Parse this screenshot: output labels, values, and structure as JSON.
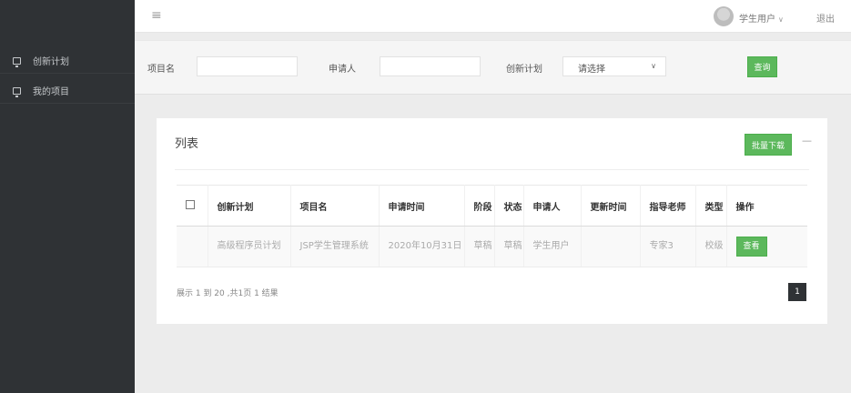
{
  "sidebar": {
    "items": [
      {
        "label": "创新计划",
        "icon": "monitor-icon"
      },
      {
        "label": "我的项目",
        "icon": "monitor-icon"
      }
    ]
  },
  "header": {
    "menu_icon": "≡",
    "user_name": "学生用户",
    "user_caret": "∨",
    "logout": "退出"
  },
  "filter": {
    "project_label": "项目名",
    "project_value": "",
    "applicant_label": "申请人",
    "applicant_value": "",
    "plan_label": "创新计划",
    "plan_selected": "请选择",
    "query_button": "查询"
  },
  "panel": {
    "title": "列表",
    "batch_download": "批量下载",
    "collapse_icon": "—"
  },
  "table": {
    "columns": [
      "创新计划",
      "项目名",
      "申请时间",
      "阶段",
      "状态",
      "申请人",
      "更新时间",
      "指导老师",
      "类型",
      "操作"
    ],
    "rows": [
      {
        "plan": "高级程序员计划",
        "project": "JSP学生管理系统",
        "apply_time": "2020年10月31日",
        "stage": "草稿",
        "status": "草稿",
        "applicant": "学生用户",
        "update_time": "",
        "teacher": "专家3",
        "type": "校级",
        "action": "查看"
      }
    ]
  },
  "pagination": {
    "summary": "展示 1 到 20 ,共1页 1 结果",
    "current_page": "1"
  },
  "colors": {
    "sidebar_bg": "#2f3235",
    "accent_green": "#5cb85c"
  }
}
